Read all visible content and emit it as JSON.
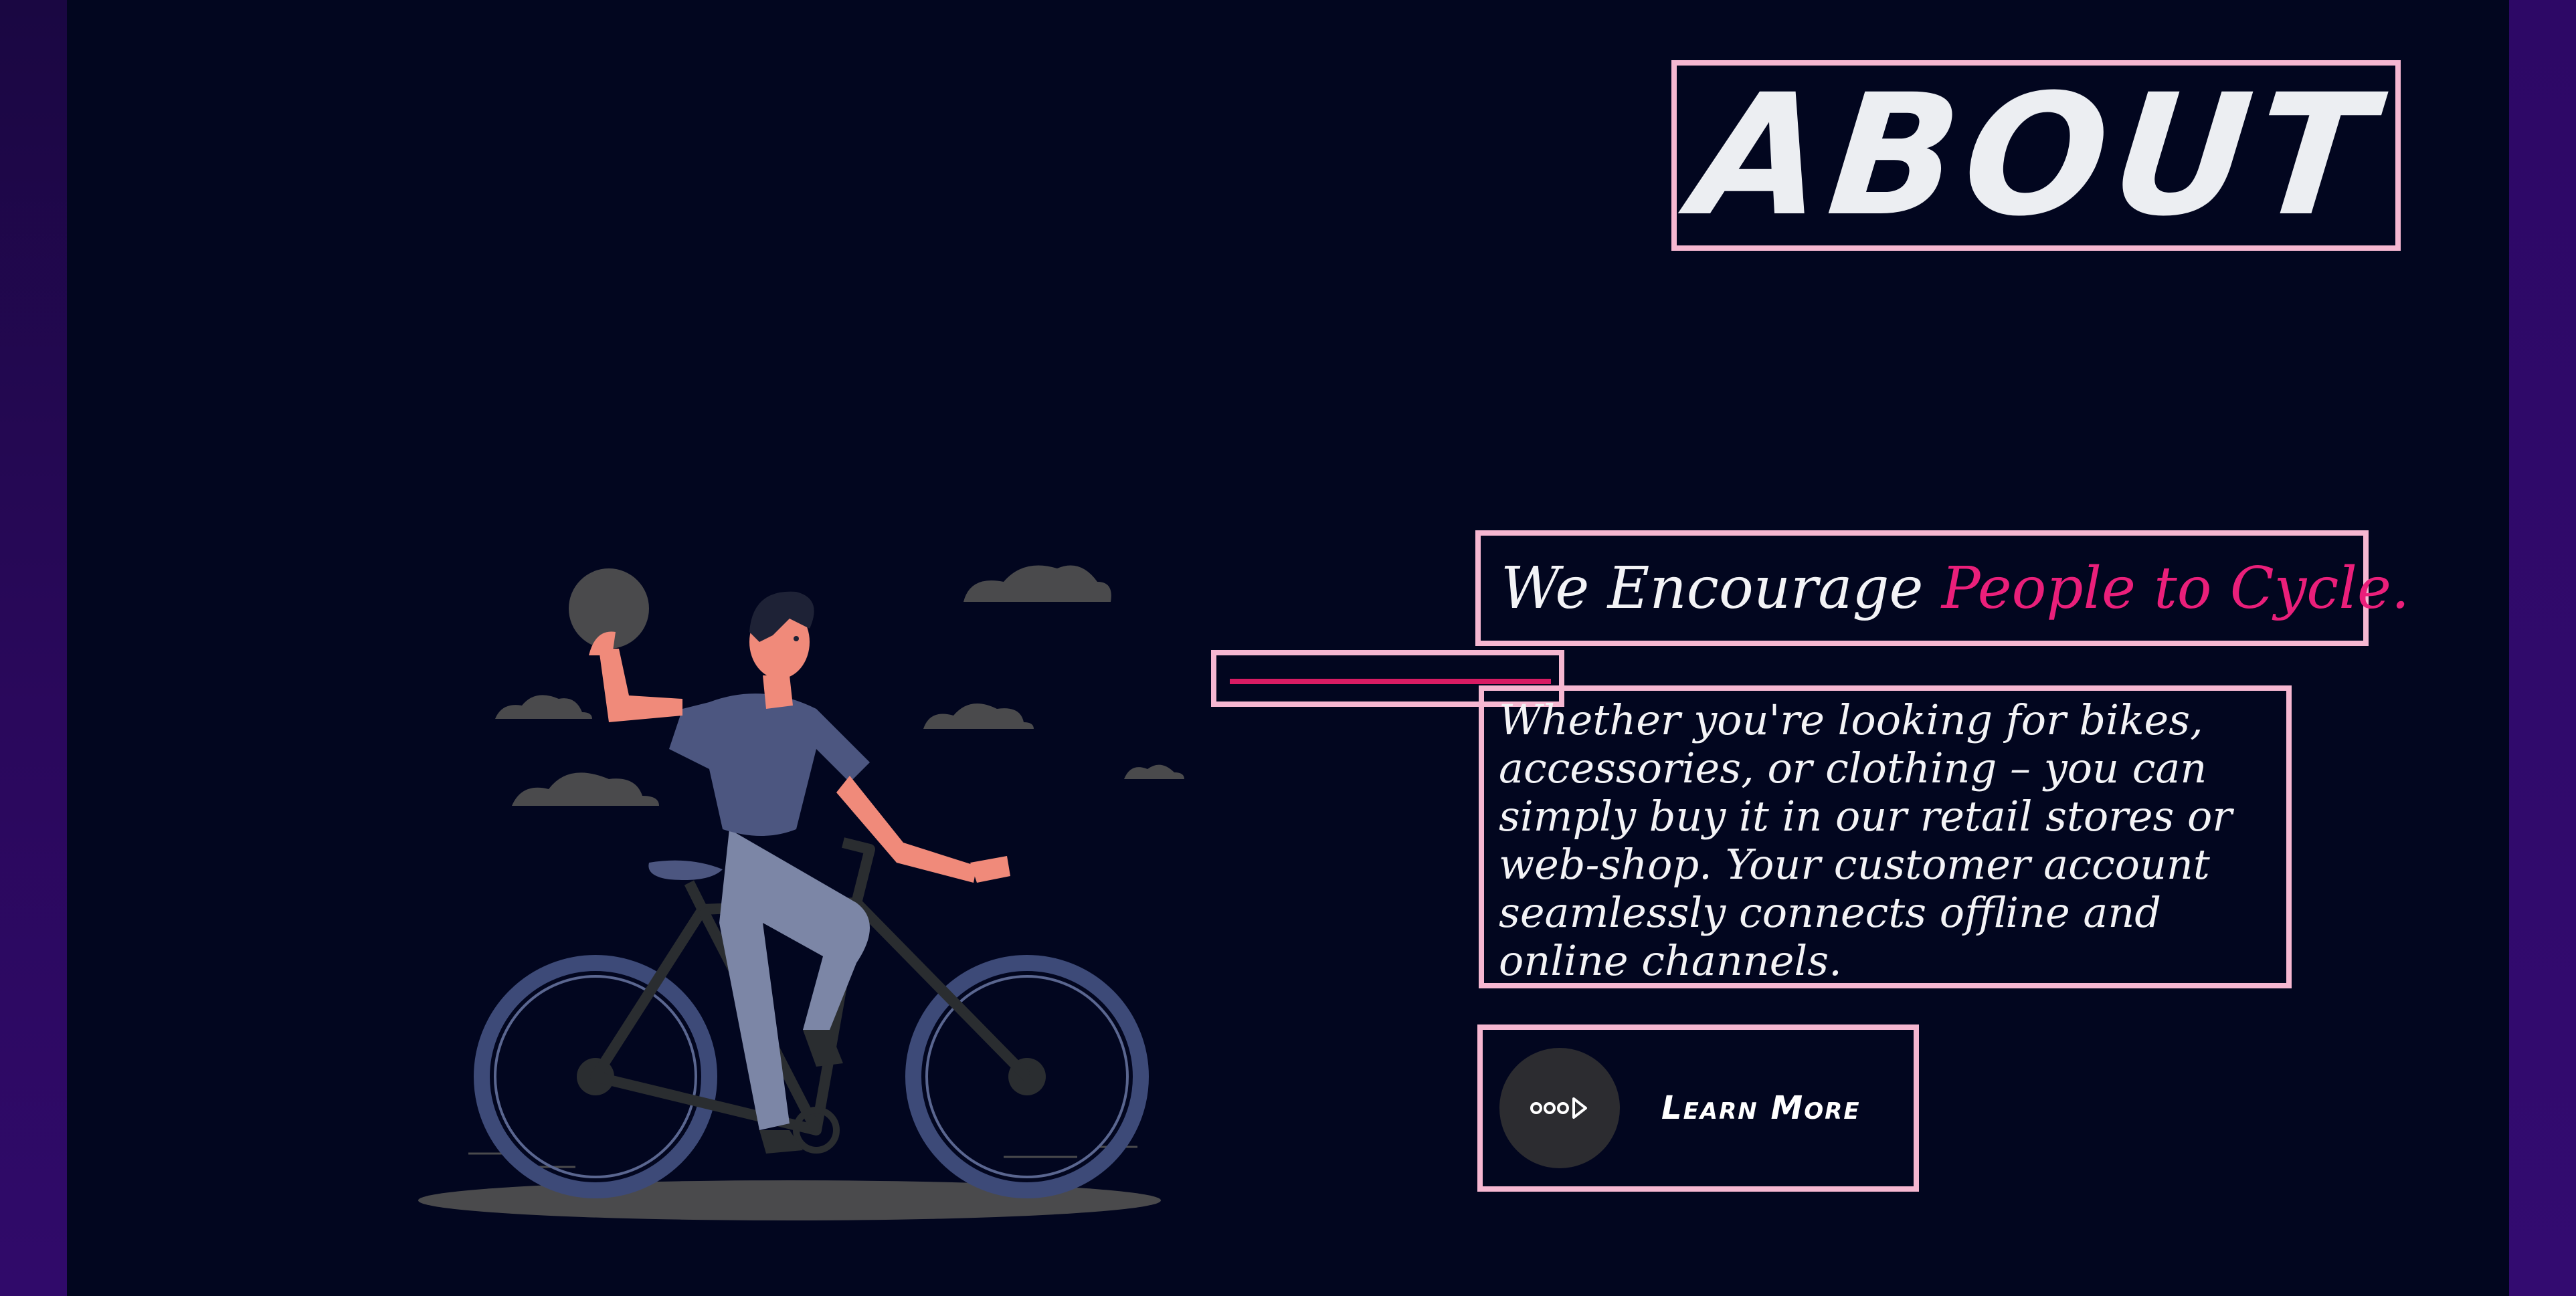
{
  "section": {
    "title": "ABOUT",
    "tagline_lead": "We Encourage",
    "tagline_accent": "People to Cycle.",
    "description": "Whether you're looking for bikes, accessories, or clothing – you can simply buy it in our retail stores or web-shop. Your customer account seamlessly connects offline and online channels.",
    "cta_label": "Learn More",
    "cta_icon": "dots-arrow-icon"
  },
  "colors": {
    "background": "#02061f",
    "gutter": "#2a0858",
    "outline": "#f6b7d1",
    "accent": "#ea1f7a",
    "text": "#f3f3f6"
  },
  "illustration": "cyclist-illustration"
}
